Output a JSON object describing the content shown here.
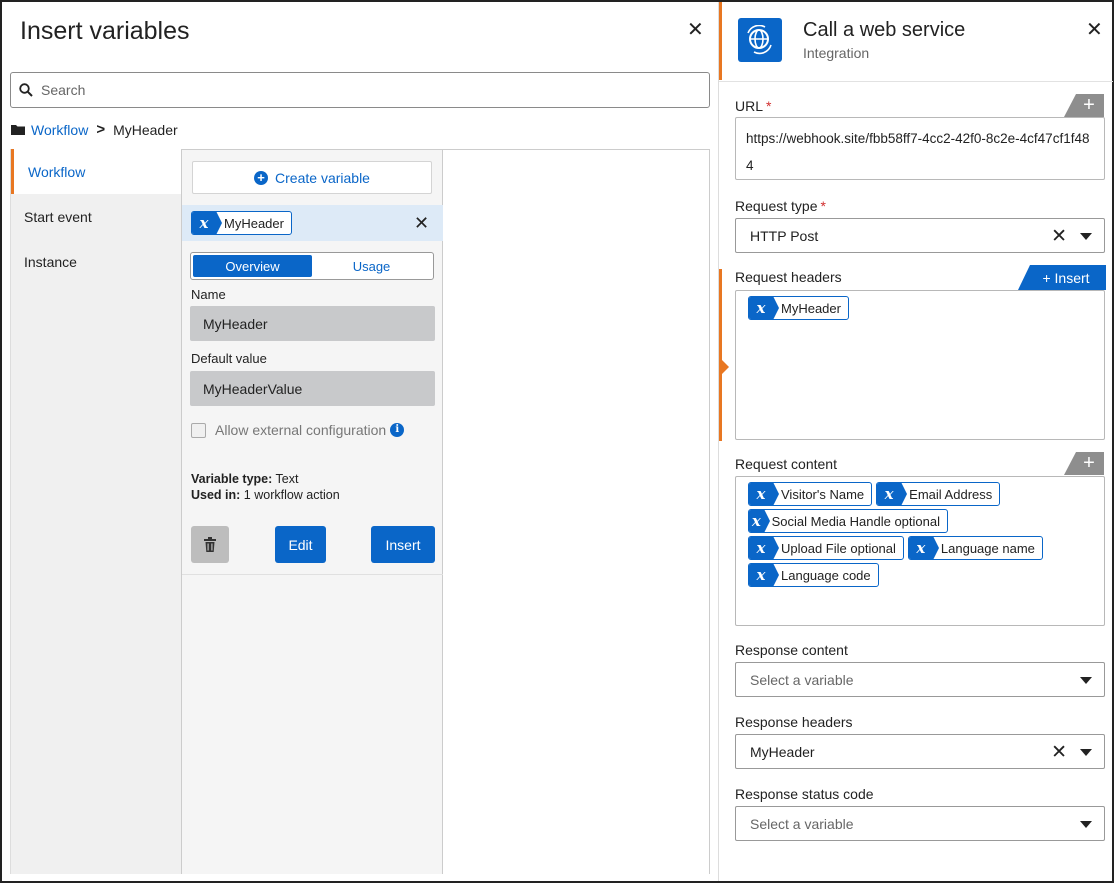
{
  "insert_panel": {
    "title": "Insert variables",
    "search_placeholder": "Search",
    "breadcrumb": {
      "root": "Workflow",
      "current": "MyHeader"
    },
    "nav": [
      "Workflow",
      "Start event",
      "Instance"
    ],
    "create_variable_label": "Create variable",
    "selected_variable": "MyHeader",
    "tabs": {
      "overview": "Overview",
      "usage": "Usage"
    },
    "name_label": "Name",
    "name_value": "MyHeader",
    "default_label": "Default value",
    "default_value": "MyHeaderValue",
    "allow_external_label": "Allow external configuration",
    "variable_type_label": "Variable type:",
    "variable_type_value": " Text",
    "used_in_label": "Used in:",
    "used_in_value": " 1 workflow action",
    "edit_label": "Edit",
    "insert_label": "Insert"
  },
  "action_panel": {
    "title": "Call a web service",
    "subtitle": "Integration",
    "url_label": "URL",
    "required_mark": "*",
    "url_value": "https://webhook.site/fbb58ff7-4cc2-42f0-8c2e-4cf47cf1f484",
    "request_type_label": "Request type",
    "request_type_value": "HTTP Post",
    "request_headers_label": "Request headers",
    "insert_tab_label": "Insert",
    "request_headers_chips": [
      "MyHeader"
    ],
    "request_content_label": "Request content",
    "request_content_chips": [
      "Visitor's Name",
      "Email Address",
      "Social Media Handle optional",
      "Upload File optional",
      "Language name",
      "Language code"
    ],
    "response_content_label": "Response content",
    "response_content_placeholder": "Select a variable",
    "response_headers_label": "Response headers",
    "response_headers_value": "MyHeader",
    "response_status_label": "Response status code",
    "response_status_placeholder": "Select a variable"
  },
  "colors": {
    "accent": "#e87722",
    "primary": "#0a66c8"
  }
}
